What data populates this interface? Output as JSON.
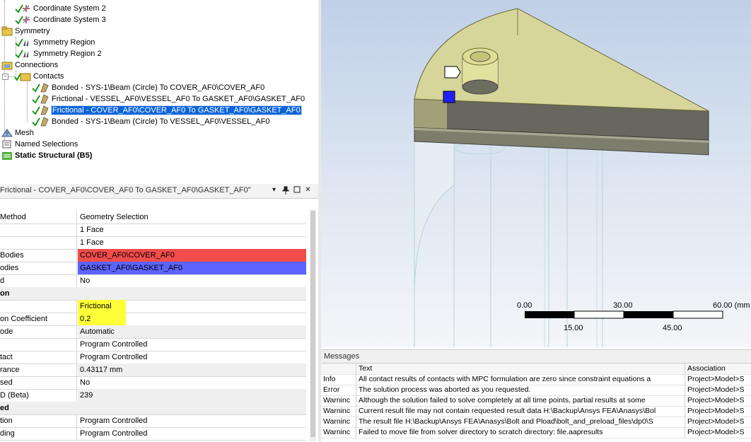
{
  "tree": {
    "items": [
      {
        "label": "Coordinate System 2"
      },
      {
        "label": "Coordinate System 3"
      },
      {
        "label": "Symmetry"
      },
      {
        "label": "Symmetry Region"
      },
      {
        "label": "Symmetry Region 2"
      },
      {
        "label": "Connections"
      },
      {
        "label": "Contacts"
      },
      {
        "label": "Bonded - SYS-1\\Beam (Circle) To COVER_AF0\\COVER_AF0"
      },
      {
        "label": "Frictional - VESSEL_AF0\\VESSEL_AF0 To GASKET_AF0\\GASKET_AF0"
      },
      {
        "label": "Frictional - COVER_AF0\\COVER_AF0 To GASKET_AF0\\GASKET_AF0"
      },
      {
        "label": "Bonded - SYS-1\\Beam (Circle) To VESSEL_AF0\\VESSEL_AF0"
      },
      {
        "label": "Mesh"
      },
      {
        "label": "Named Selections"
      },
      {
        "label": "Static Structural (B5)"
      }
    ]
  },
  "details": {
    "title": "Frictional - COVER_AF0\\COVER_AF0 To GASKET_AF0\\GASKET_AF0\"",
    "rows": [
      {
        "key": "Method",
        "value": "Geometry Selection"
      },
      {
        "key": "",
        "value": "1 Face"
      },
      {
        "key": "",
        "value": "1 Face"
      },
      {
        "key": "Bodies",
        "value": "COVER_AF0\\COVER_AF0"
      },
      {
        "key": "odies",
        "value": "GASKET_AF0\\GASKET_AF0"
      },
      {
        "key": "d",
        "value": "No"
      },
      {
        "key": "on",
        "value": ""
      },
      {
        "key": "",
        "value": "Frictional"
      },
      {
        "key": "on Coefficient",
        "value": "0.2"
      },
      {
        "key": "ode",
        "value": "Automatic"
      },
      {
        "key": "",
        "value": "Program Controlled"
      },
      {
        "key": "tact",
        "value": "Program Controlled"
      },
      {
        "key": "rance",
        "value": "0.43117 mm"
      },
      {
        "key": "sed",
        "value": "No"
      },
      {
        "key": "D (Beta)",
        "value": "239"
      },
      {
        "key": "ed",
        "value": ""
      },
      {
        "key": "tion",
        "value": "Program Controlled"
      },
      {
        "key": "ding",
        "value": "Program Controlled"
      }
    ]
  },
  "scale": {
    "t0": "0.00",
    "t30": "30.00",
    "t60": "60.00 (mm",
    "t15": "15.00",
    "t45": "45.00"
  },
  "messages": {
    "title": "Messages",
    "header": {
      "type": "",
      "text": "Text",
      "assoc": "Association"
    },
    "rows": [
      {
        "type": "Info",
        "text": "All contact results of contacts with MPC formulation are zero since constraint equations a",
        "assoc": "Project>Model>S"
      },
      {
        "type": "Error",
        "text": "The solution process was aborted as you requested.",
        "assoc": "Project>Model>S"
      },
      {
        "type": "Warninc",
        "text": "Although the solution failed to solve completely at all time points, partial results at some",
        "assoc": "Project>Model>S"
      },
      {
        "type": "Warninc",
        "text": "Current result file may not contain requested result data H:\\Backup\\Ansys FEA\\Anasys\\Bol",
        "assoc": "Project>Model>S"
      },
      {
        "type": "Warninc",
        "text": "The result file H:\\Backup\\Ansys FEA\\Anasys\\Bolt and Pload\\bolt_and_preload_files\\dp0\\S",
        "assoc": "Project>Model>S"
      },
      {
        "type": "Warninc",
        "text": "Failed to move file from solver directory to scratch directory: file.aapresults",
        "assoc": "Project>Model>S"
      }
    ]
  },
  "colors": {
    "contact_body": "#f24c4c",
    "target_body": "#5c63ff",
    "highlight": "#ffff38",
    "selection": "#0a64d8"
  }
}
